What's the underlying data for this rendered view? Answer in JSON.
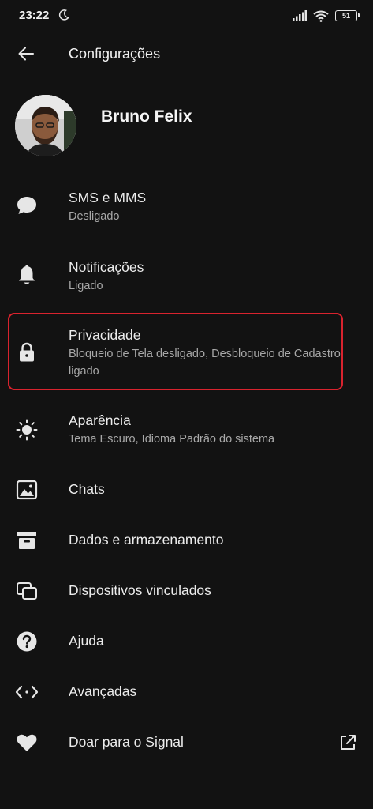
{
  "status_bar": {
    "time": "23:22",
    "battery": "51"
  },
  "app_bar": {
    "title": "Configurações"
  },
  "profile": {
    "name": "Bruno Felix"
  },
  "items": [
    {
      "title": "SMS e MMS",
      "subtitle": "Desligado",
      "icon": "chat-bubble-icon"
    },
    {
      "title": "Notificações",
      "subtitle": "Ligado",
      "icon": "bell-icon"
    },
    {
      "title": "Privacidade",
      "subtitle": "Bloqueio de Tela desligado, Desbloqueio de Cadastro ligado",
      "icon": "lock-icon"
    },
    {
      "title": "Aparência",
      "subtitle": "Tema Escuro, Idioma Padrão do sistema",
      "icon": "sun-icon"
    },
    {
      "title": "Chats",
      "icon": "image-icon"
    },
    {
      "title": "Dados e armazenamento",
      "icon": "archive-icon"
    },
    {
      "title": "Dispositivos vinculados",
      "icon": "devices-icon"
    },
    {
      "title": "Ajuda",
      "icon": "help-icon"
    },
    {
      "title": "Avançadas",
      "icon": "code-icon"
    },
    {
      "title": "Doar para o Signal",
      "icon": "heart-icon"
    }
  ],
  "colors": {
    "background": "#121212",
    "highlight": "#d9232e"
  }
}
